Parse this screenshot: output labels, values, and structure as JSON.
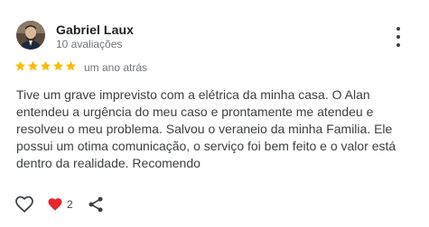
{
  "review": {
    "reviewer_name": "Gabriel Laux",
    "review_count": "10 avaliações",
    "rating": 5,
    "date": "um ano atrás",
    "text": "Tive um grave imprevisto com a elétrica da minha casa. O Alan entendeu a urgência do meu caso e prontamente me atendeu e resolveu o meu problema. Salvou o veraneio da minha Familia. Ele possui um otima comunicação, o serviço foi bem feito e o valor está dentro da realidade. Recomendo"
  },
  "reactions": {
    "heart_count": "2"
  },
  "icons": {
    "like": "heart-outline-icon",
    "reaction": "red-heart-icon",
    "share": "share-icon",
    "menu": "more-vertical-icon"
  },
  "colors": {
    "star": "#fbbc04",
    "heart": "#e8262c",
    "name": "#202124",
    "secondary": "#70757a"
  }
}
